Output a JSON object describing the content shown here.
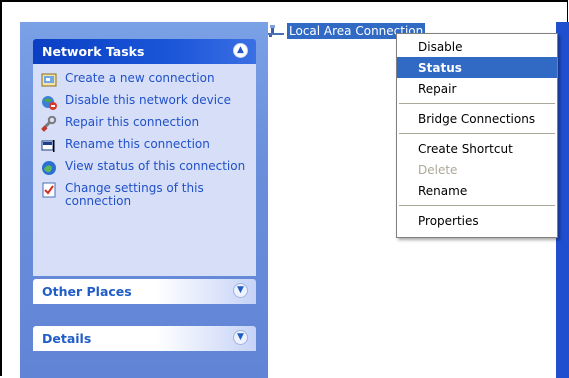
{
  "sidebar": {
    "network_tasks": {
      "title": "Network Tasks",
      "items": [
        {
          "label": "Create a new connection",
          "icon": "new-connection-icon"
        },
        {
          "label": "Disable this network device",
          "icon": "disable-device-icon"
        },
        {
          "label": "Repair this connection",
          "icon": "repair-icon"
        },
        {
          "label": "Rename this connection",
          "icon": "rename-icon"
        },
        {
          "label": "View status of this connection",
          "icon": "status-icon"
        },
        {
          "label": "Change settings of this connection",
          "icon": "settings-icon"
        }
      ]
    },
    "other_places": {
      "title": "Other Places"
    },
    "details": {
      "title": "Details"
    }
  },
  "main": {
    "connection": {
      "label": "Local Area Connection",
      "icon": "network-connection-icon"
    }
  },
  "context_menu": {
    "items": [
      {
        "label": "Disable",
        "state": "normal"
      },
      {
        "label": "Status",
        "state": "selected"
      },
      {
        "label": "Repair",
        "state": "normal"
      },
      {
        "separator": true
      },
      {
        "label": "Bridge Connections",
        "state": "normal"
      },
      {
        "separator": true
      },
      {
        "label": "Create Shortcut",
        "state": "normal"
      },
      {
        "label": "Delete",
        "state": "disabled"
      },
      {
        "label": "Rename",
        "state": "normal"
      },
      {
        "separator": true
      },
      {
        "label": "Properties",
        "state": "normal"
      }
    ]
  },
  "colors": {
    "sidebar_bg": "#6a8edb",
    "header_blue": "#0a3fc4",
    "link_blue": "#2150c9",
    "selection": "#316ac5"
  }
}
